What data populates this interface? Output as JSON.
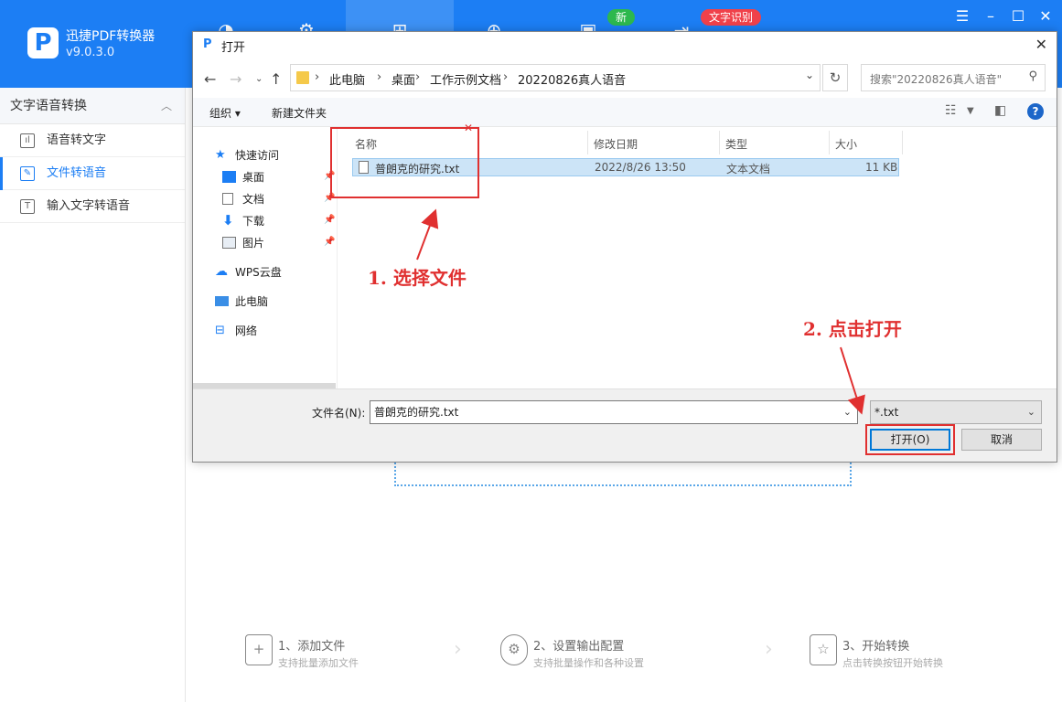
{
  "app": {
    "name": "迅捷PDF转换器",
    "version": "v9.0.3.0",
    "badge_new": "新",
    "badge_ocr": "文字识别",
    "colors": {
      "brand": "#1c7ef4",
      "annotation": "#e03030"
    }
  },
  "sidebar": {
    "header": "文字语音转换",
    "items": [
      {
        "label": "语音转文字",
        "icon": "waveform-icon"
      },
      {
        "label": "文件转语音",
        "icon": "edit-icon"
      },
      {
        "label": "输入文字转语音",
        "icon": "text-icon"
      }
    ]
  },
  "steps": [
    {
      "title": "1、添加文件",
      "sub": "支持批量添加文件",
      "icon": "add-file-icon"
    },
    {
      "title": "2、设置输出配置",
      "sub": "支持批量操作和各种设置",
      "icon": "settings-icon"
    },
    {
      "title": "3、开始转换",
      "sub": "点击转换按钮开始转换",
      "icon": "convert-icon"
    }
  ],
  "dialog": {
    "title": "打开",
    "breadcrumb": [
      "此电脑",
      "桌面",
      "工作示例文档",
      "20220826真人语音"
    ],
    "search_placeholder": "搜索\"20220826真人语音\"",
    "toolbar": {
      "organize": "组织 ▾",
      "new_folder": "新建文件夹"
    },
    "nav": {
      "quick_access": "快速访问",
      "desktop": "桌面",
      "documents": "文档",
      "downloads": "下载",
      "pictures": "图片",
      "wps": "WPS云盘",
      "this_pc": "此电脑",
      "network": "网络"
    },
    "columns": {
      "name": "名称",
      "date": "修改日期",
      "type": "类型",
      "size": "大小"
    },
    "files": [
      {
        "name": "普朗克的研究.txt",
        "date": "2022/8/26 13:50",
        "type": "文本文档",
        "size": "11 KB"
      }
    ],
    "filename_label": "文件名(N):",
    "filename_value": "普朗克的研究.txt",
    "filetype_value": "*.txt",
    "open_button": "打开(O)",
    "cancel_button": "取消"
  },
  "annotations": {
    "step1": "1. 选择文件",
    "step2": "2. 点击打开"
  }
}
